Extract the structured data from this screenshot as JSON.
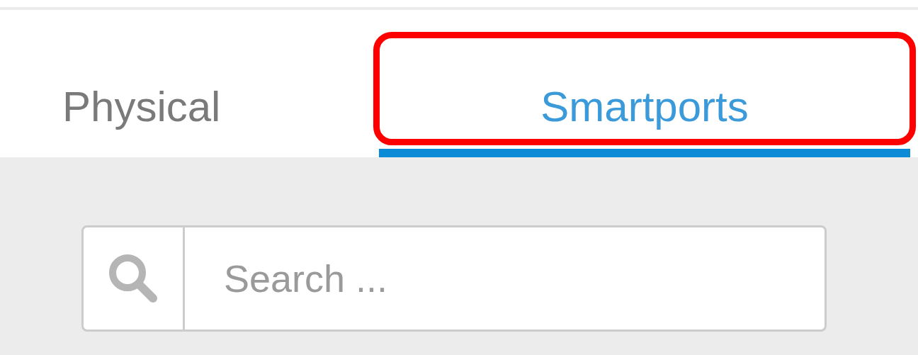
{
  "tabs": [
    {
      "label": "Physical",
      "selected": false,
      "highlighted": false
    },
    {
      "label": "Smartports",
      "selected": true,
      "highlighted": true
    }
  ],
  "search": {
    "placeholder": "Search ..."
  }
}
